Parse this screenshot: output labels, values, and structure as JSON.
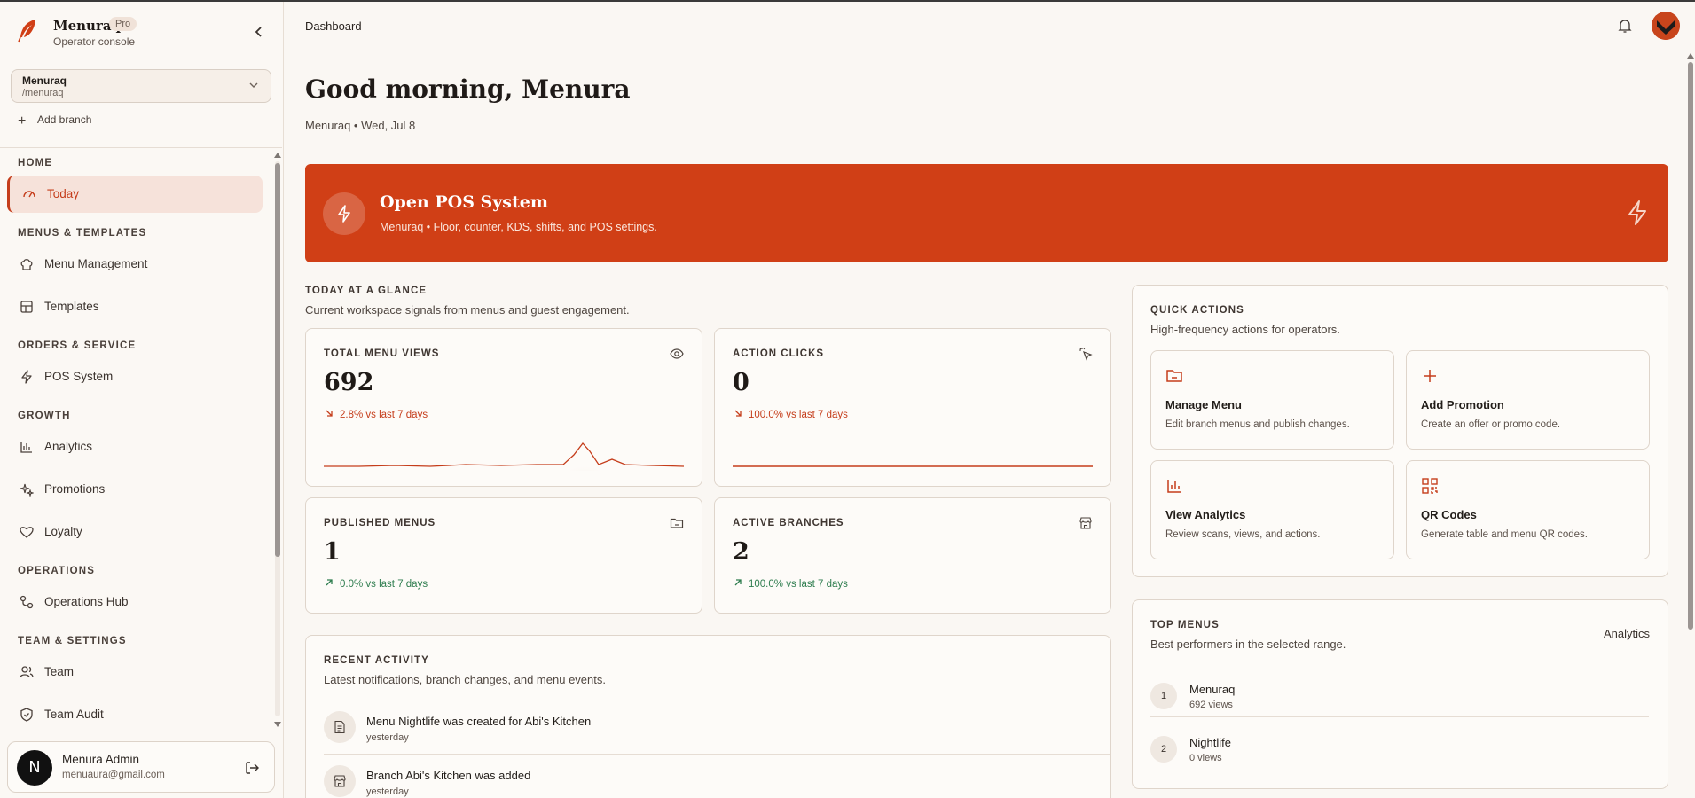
{
  "brand": {
    "name": "Menuraq",
    "badge": "Pro",
    "subtitle": "Operator console"
  },
  "branch_selector": {
    "name": "Menuraq",
    "path": "/menuraq"
  },
  "add_branch_label": "Add branch",
  "nav": {
    "sections": [
      {
        "title": "HOME",
        "items": [
          {
            "label": "Today",
            "icon": "gauge-icon",
            "active": true
          }
        ]
      },
      {
        "title": "MENUS & TEMPLATES",
        "items": [
          {
            "label": "Menu Management",
            "icon": "chef-hat-icon"
          },
          {
            "label": "Templates",
            "icon": "layout-icon"
          }
        ]
      },
      {
        "title": "ORDERS & SERVICE",
        "items": [
          {
            "label": "POS System",
            "icon": "bolt-icon"
          }
        ]
      },
      {
        "title": "GROWTH",
        "items": [
          {
            "label": "Analytics",
            "icon": "bar-chart-icon"
          },
          {
            "label": "Promotions",
            "icon": "sparkles-icon"
          },
          {
            "label": "Loyalty",
            "icon": "heart-icon"
          }
        ]
      },
      {
        "title": "OPERATIONS",
        "items": [
          {
            "label": "Operations Hub",
            "icon": "workflow-icon"
          }
        ]
      },
      {
        "title": "TEAM & SETTINGS",
        "items": [
          {
            "label": "Team",
            "icon": "users-icon"
          },
          {
            "label": "Team Audit",
            "icon": "shield-icon"
          }
        ]
      }
    ]
  },
  "user": {
    "initial": "N",
    "name": "Menura Admin",
    "email": "menuaura@gmail.com"
  },
  "topbar": {
    "breadcrumb": "Dashboard"
  },
  "greeting": "Good morning, Menura",
  "date_line": "Menuraq • Wed, Jul 8",
  "pos_banner": {
    "title": "Open POS System",
    "description": "Menuraq • Floor, counter, KDS, shifts, and POS settings."
  },
  "glance": {
    "title": "TODAY AT A GLANCE",
    "description": "Current workspace signals from menus and guest engagement."
  },
  "stats": [
    {
      "name": "TOTAL MENU VIEWS",
      "value": "692",
      "delta": "2.8% vs last 7 days",
      "trend": "down",
      "icon": "eye-icon"
    },
    {
      "name": "ACTION CLICKS",
      "value": "0",
      "delta": "100.0% vs last 7 days",
      "trend": "down",
      "icon": "cursor-click-icon"
    },
    {
      "name": "PUBLISHED MENUS",
      "value": "1",
      "delta": "0.0% vs last 7 days",
      "trend": "up",
      "icon": "folder-icon"
    },
    {
      "name": "ACTIVE BRANCHES",
      "value": "2",
      "delta": "100.0% vs last 7 days",
      "trend": "up",
      "icon": "store-icon"
    }
  ],
  "quick_actions": {
    "title": "QUICK ACTIONS",
    "description": "High-frequency actions for operators.",
    "tiles": [
      {
        "title": "Manage Menu",
        "description": "Edit branch menus and publish changes.",
        "icon": "folder-icon"
      },
      {
        "title": "Add Promotion",
        "description": "Create an offer or promo code.",
        "icon": "plus-icon"
      },
      {
        "title": "View Analytics",
        "description": "Review scans, views, and actions.",
        "icon": "bar-chart-icon"
      },
      {
        "title": "QR Codes",
        "description": "Generate table and menu QR codes.",
        "icon": "qr-code-icon"
      }
    ]
  },
  "top_menus": {
    "title": "TOP MENUS",
    "description": "Best performers in the selected range.",
    "link": "Analytics",
    "items": [
      {
        "rank": "1",
        "name": "Menuraq",
        "views": "692 views"
      },
      {
        "rank": "2",
        "name": "Nightlife",
        "views": "0 views"
      }
    ]
  },
  "recent_activity": {
    "title": "RECENT ACTIVITY",
    "description": "Latest notifications, branch changes, and menu events.",
    "items": [
      {
        "text": "Menu Nightlife was created for Abi's Kitchen",
        "time": "yesterday",
        "icon": "file-icon"
      },
      {
        "text": "Branch Abi's Kitchen was added",
        "time": "yesterday",
        "icon": "store-icon"
      }
    ]
  },
  "colors": {
    "accent": "#d03f16",
    "accent_text": "#c53d1b",
    "positive": "#2f7d4f",
    "background": "#faf7f3"
  }
}
